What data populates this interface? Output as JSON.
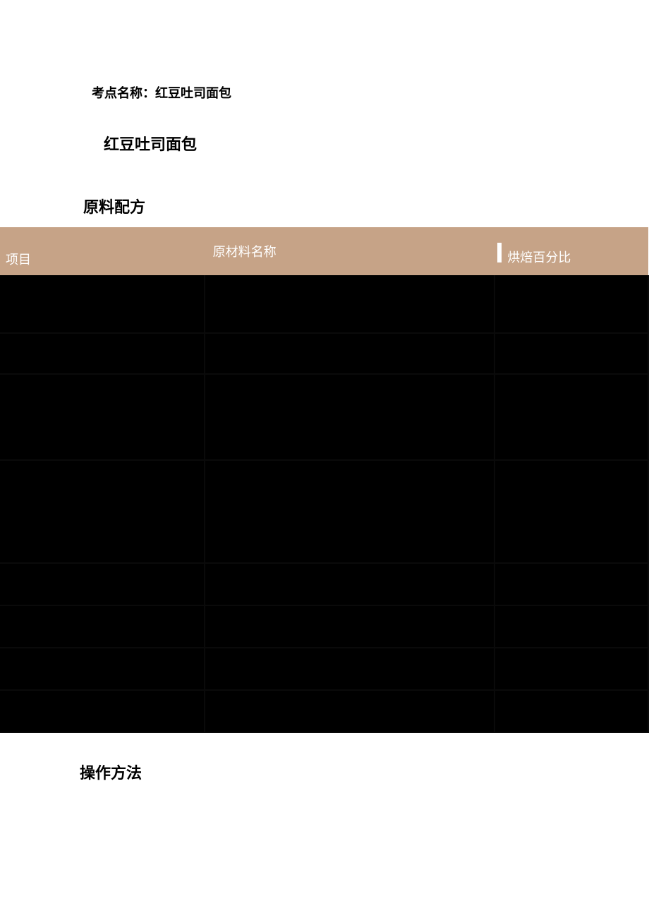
{
  "topic_label": "考点名称：红豆吐司面包",
  "title": "红豆吐司面包",
  "section_ingredients": "原料配方",
  "section_method": "操作方法",
  "table_headers": {
    "col1": "项目",
    "col2": "原材料名称",
    "col3": "烘焙百分比"
  }
}
